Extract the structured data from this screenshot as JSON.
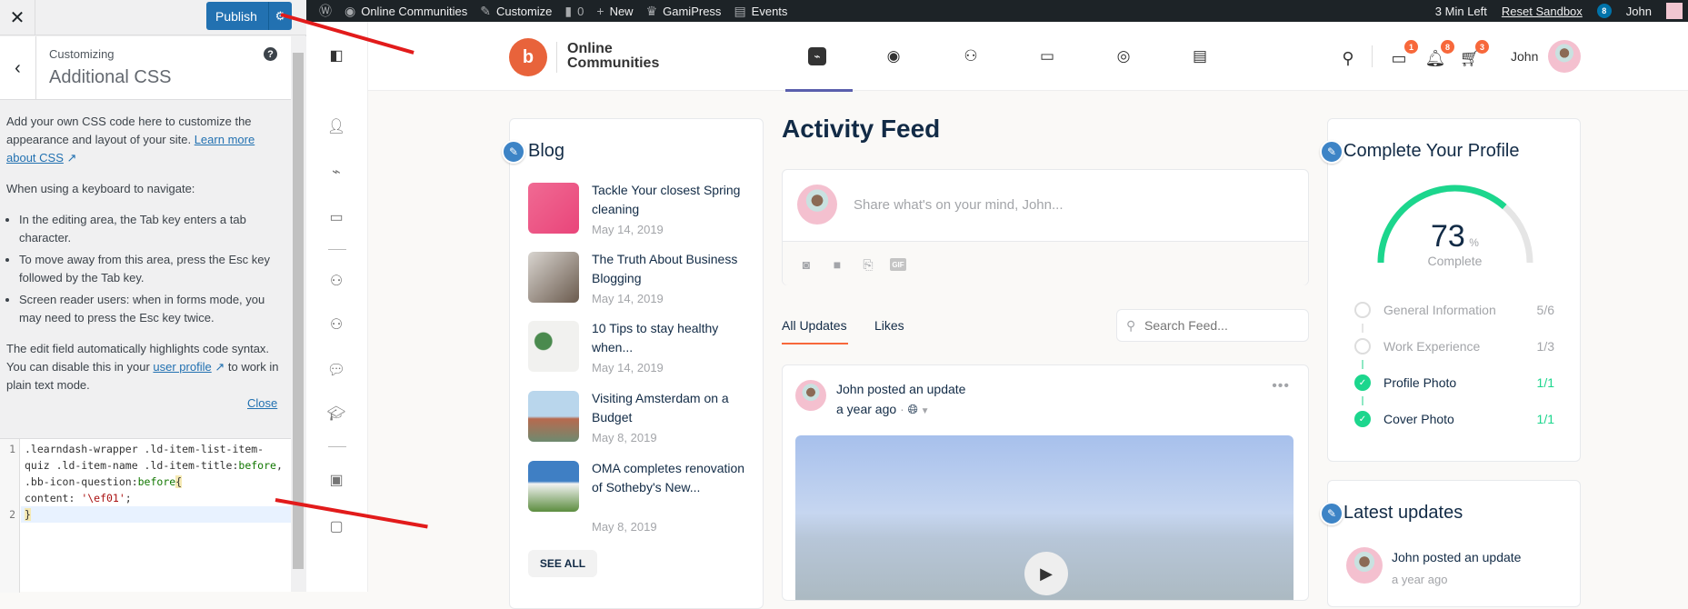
{
  "customizer": {
    "publish_label": "Publish",
    "subtitle": "Customizing",
    "title": "Additional CSS",
    "desc_p1_text": "Add your own CSS code here to customize the appearance and layout of your site. ",
    "desc_p1_link": "Learn more about CSS",
    "keyboard_heading": "When using a keyboard to navigate:",
    "bullets": [
      "In the editing area, the Tab key enters a tab character.",
      "To move away from this area, press the Esc key followed by the Tab key.",
      "Screen reader users: when in forms mode, you may need to press the Esc key twice."
    ],
    "desc_p3_text_a": "The edit field automatically highlights code syntax. You can disable this in your ",
    "desc_p3_link": "user profile",
    "desc_p3_text_b": " to work in plain text mode.",
    "close_label": "Close",
    "code": {
      "line_numbers": [
        "1",
        "2"
      ],
      "l1a": ".learndash-wrapper .ld-item-list-item-quiz .ld-item-name .ld-item-title:",
      "l1b": "before",
      "l1c": ", .bb-icon-question:",
      "l1d": "before",
      "l1e": "{",
      "l2a": "content: ",
      "l2b": "'\\ef01'",
      "l2c": ";",
      "l3": "}"
    }
  },
  "adminbar": {
    "items": [
      "Online Communities",
      "Customize",
      "0",
      "New",
      "GamiPress",
      "Events"
    ],
    "time_left": "3 Min Left",
    "reset": "Reset Sandbox",
    "badge": "8",
    "user": "John"
  },
  "header": {
    "logo_line1": "Online",
    "logo_line2": "Communities",
    "user": "John",
    "badges": {
      "messages": "1",
      "notifications": "8",
      "cart": "3"
    },
    "accent": "#5a5fad",
    "badge_color": "#f7683b"
  },
  "blog": {
    "title": "Blog",
    "posts": [
      {
        "title": "Tackle Your closest Spring cleaning",
        "date": "May 14, 2019"
      },
      {
        "title": "The Truth About Business Blogging",
        "date": "May 14, 2019"
      },
      {
        "title": "10 Tips to stay healthy when...",
        "date": "May 14, 2019"
      },
      {
        "title": "Visiting Amsterdam on a Budget",
        "date": "May 8, 2019"
      },
      {
        "title": "OMA completes renovation of Sotheby's New...",
        "date": "May 8, 2019"
      }
    ],
    "see_all": "SEE ALL"
  },
  "feed": {
    "title": "Activity Feed",
    "composer_placeholder": "Share what's on your mind, John...",
    "tabs": [
      "All Updates",
      "Likes"
    ],
    "search_placeholder": "Search Feed...",
    "post": {
      "author": "John",
      "action": " posted an update",
      "time": "a year ago",
      "sep": "·"
    }
  },
  "profile": {
    "title": "Complete Your Profile",
    "percent": 73,
    "percent_symbol": "%",
    "label": "Complete",
    "items": [
      {
        "label": "General Information",
        "value": "5/6",
        "done": false
      },
      {
        "label": "Work Experience",
        "value": "1/3",
        "done": false
      },
      {
        "label": "Profile Photo",
        "value": "1/1",
        "done": true
      },
      {
        "label": "Cover Photo",
        "value": "1/1",
        "done": true
      }
    ],
    "done_color": "#1cd68d"
  },
  "latest": {
    "title": "Latest updates",
    "author": "John",
    "action": " posted an update",
    "time": "a year ago"
  }
}
